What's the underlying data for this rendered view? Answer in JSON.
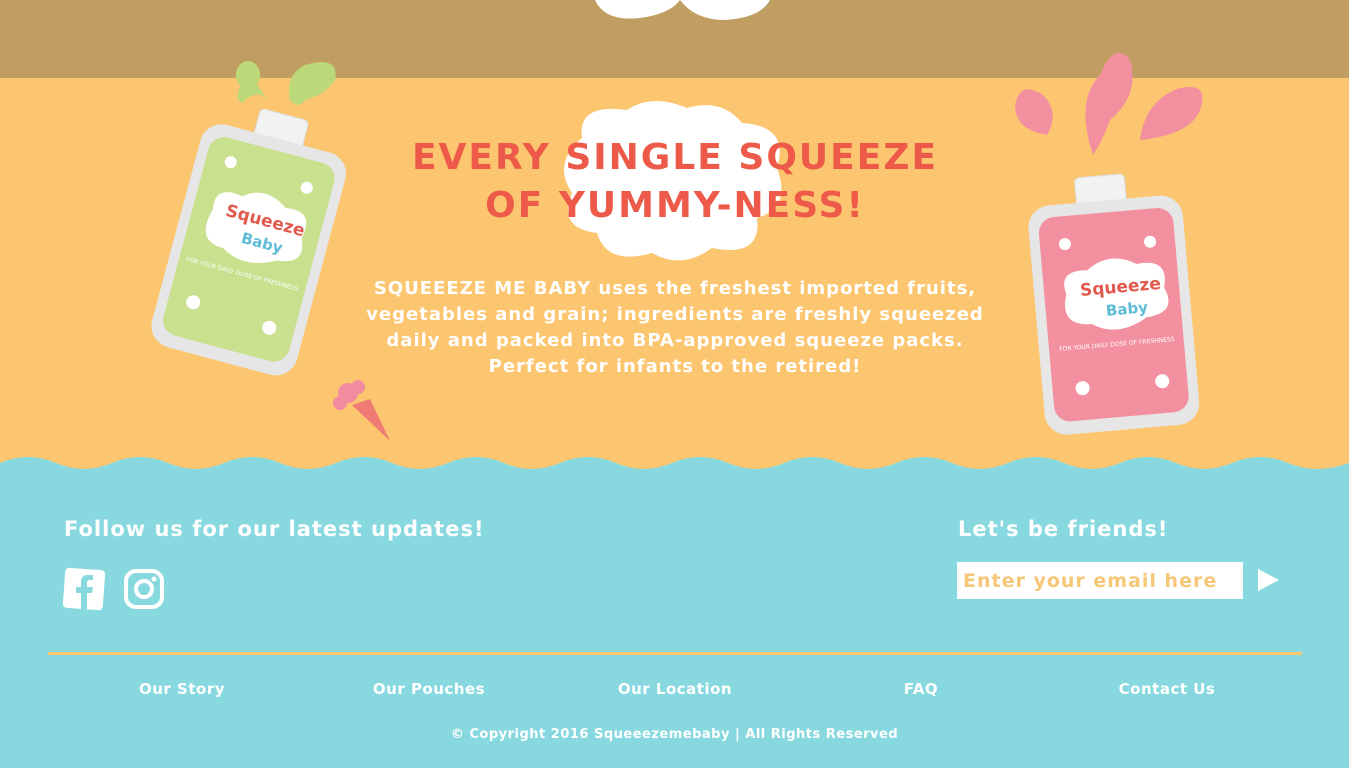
{
  "hero": {
    "headline_line1": "EVERY SINGLE SQUEEZE",
    "headline_line2": "OF YUMMY-NESS!",
    "description": "SQUEEEZE ME BABY uses the freshest imported fruits, vegetables and grain; ingredients are freshly squeezed daily and packed into BPA-approved squeeze packs. Perfect for infants to the retired!"
  },
  "pouches": [
    {
      "brand_top": "Squeeze",
      "brand_bottom": "Baby",
      "tagline": "FOR YOUR DAILY DOSE OF FRESHNESS",
      "color": "#c9e08f"
    },
    {
      "brand_top": "Squeeze",
      "brand_bottom": "Baby",
      "tagline": "FOR YOUR DAILY DOSE OF FRESHNESS",
      "color": "#f3909f"
    }
  ],
  "footer": {
    "follow_title": "Follow us for our latest updates!",
    "social_icons": [
      "facebook-icon",
      "instagram-icon"
    ],
    "friends_title": "Let's be friends!",
    "email_placeholder": "Enter your email here",
    "send_icon": "play-arrow-icon",
    "nav": [
      "Our Story",
      "Our Pouches",
      "Our Location",
      "FAQ",
      "Contact Us"
    ],
    "copyright": "© Copyright 2016 Squeeezemebaby | All Rights Reserved"
  },
  "colors": {
    "top_band": "#c09d60",
    "hero_bg": "#fcc56f",
    "footer_bg": "#88d9df",
    "headline": "#ee5a4a",
    "green_pouch": "#c9e08f",
    "pink_pouch": "#f3909f"
  }
}
